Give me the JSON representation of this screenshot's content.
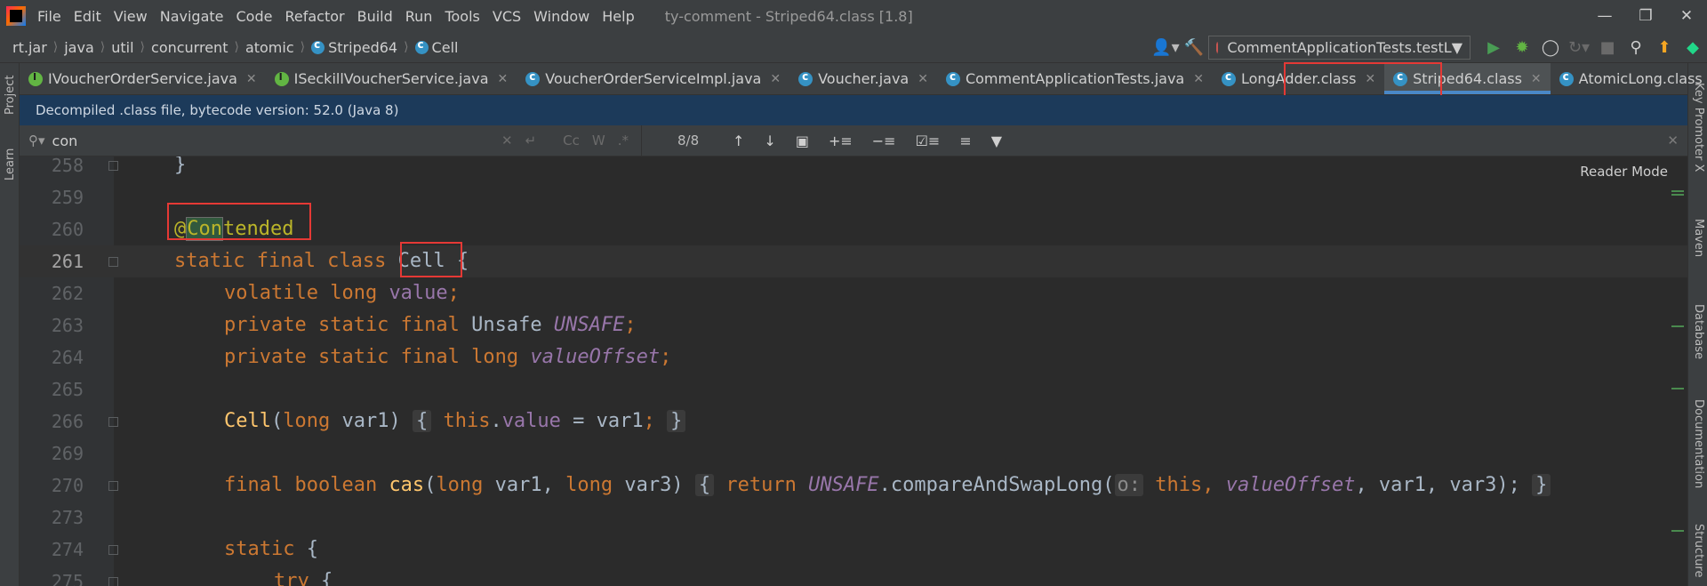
{
  "menu": {
    "items": [
      "File",
      "Edit",
      "View",
      "Navigate",
      "Code",
      "Refactor",
      "Build",
      "Run",
      "Tools",
      "VCS",
      "Window",
      "Help"
    ],
    "window_title": "ty-comment - Striped64.class [1.8]"
  },
  "breadcrumb": [
    "rt.jar",
    "java",
    "util",
    "concurrent",
    "atomic",
    "Striped64",
    "Cell"
  ],
  "run_config": "CommentApplicationTests.testL",
  "tabs": [
    {
      "label": "IVoucherOrderService.java",
      "icon": "interface-icon"
    },
    {
      "label": "ISeckillVoucherService.java",
      "icon": "interface-icon"
    },
    {
      "label": "VoucherOrderServiceImpl.java",
      "icon": "class-icon"
    },
    {
      "label": "Voucher.java",
      "icon": "class-icon"
    },
    {
      "label": "CommentApplicationTests.java",
      "icon": "class-icon"
    },
    {
      "label": "LongAdder.class",
      "icon": "class-icon"
    },
    {
      "label": "Striped64.class",
      "icon": "class-icon",
      "active": true
    },
    {
      "label": "AtomicLong.class",
      "icon": "class-icon"
    }
  ],
  "banner": "Decompiled .class file, bytecode version: 52.0 (Java 8)",
  "search": {
    "value": "con",
    "count": "8/8",
    "case_label": "Cc",
    "word_label": "W",
    "regex_label": ".*"
  },
  "reader_mode": "Reader Mode",
  "left_tools": [
    "Project",
    "Learn"
  ],
  "right_tools": [
    "Key Promoter X",
    "Maven",
    "Database",
    "Documentation",
    "Structure"
  ],
  "code": {
    "line_numbers": [
      "258",
      "259",
      "260",
      "261",
      "262",
      "263",
      "264",
      "265",
      "266",
      "269",
      "270",
      "273",
      "274",
      "275"
    ],
    "l258": "}",
    "l260_at": "@",
    "l260_match": "Con",
    "l260_rest": "tended",
    "l261_kw": "static final class",
    "l261_name": "Cell",
    "l261_brace": "{",
    "l262_kw": "volatile long",
    "l262_field": "value",
    "l263_kw": "private static final",
    "l263_type": "Unsafe",
    "l263_field": "UNSAFE",
    "l264_kw": "private static final long",
    "l264_field": "valueOffset",
    "l266_fn": "Cell",
    "l266_params_kw": "long",
    "l266_param": "var1)",
    "l266_body_kw": "this",
    "l266_field": "value",
    "l266_rest": " = var1",
    "l270_kw": "final boolean",
    "l270_fn": "cas",
    "l270_long1": "long",
    "l270_p1": "var1,",
    "l270_long2": "long",
    "l270_p2": "var3)",
    "l270_return": "return",
    "l270_unsafe": "UNSAFE",
    "l270_call": ".compareAndSwapLong(",
    "l270_hint": "o:",
    "l270_this": "this",
    "l270_offset": "valueOffset",
    "l270_args": ", var1, var3);",
    "l274_kw": "static",
    "l274_brace": "{",
    "l275_kw": "try",
    "l275_brace": "{"
  }
}
